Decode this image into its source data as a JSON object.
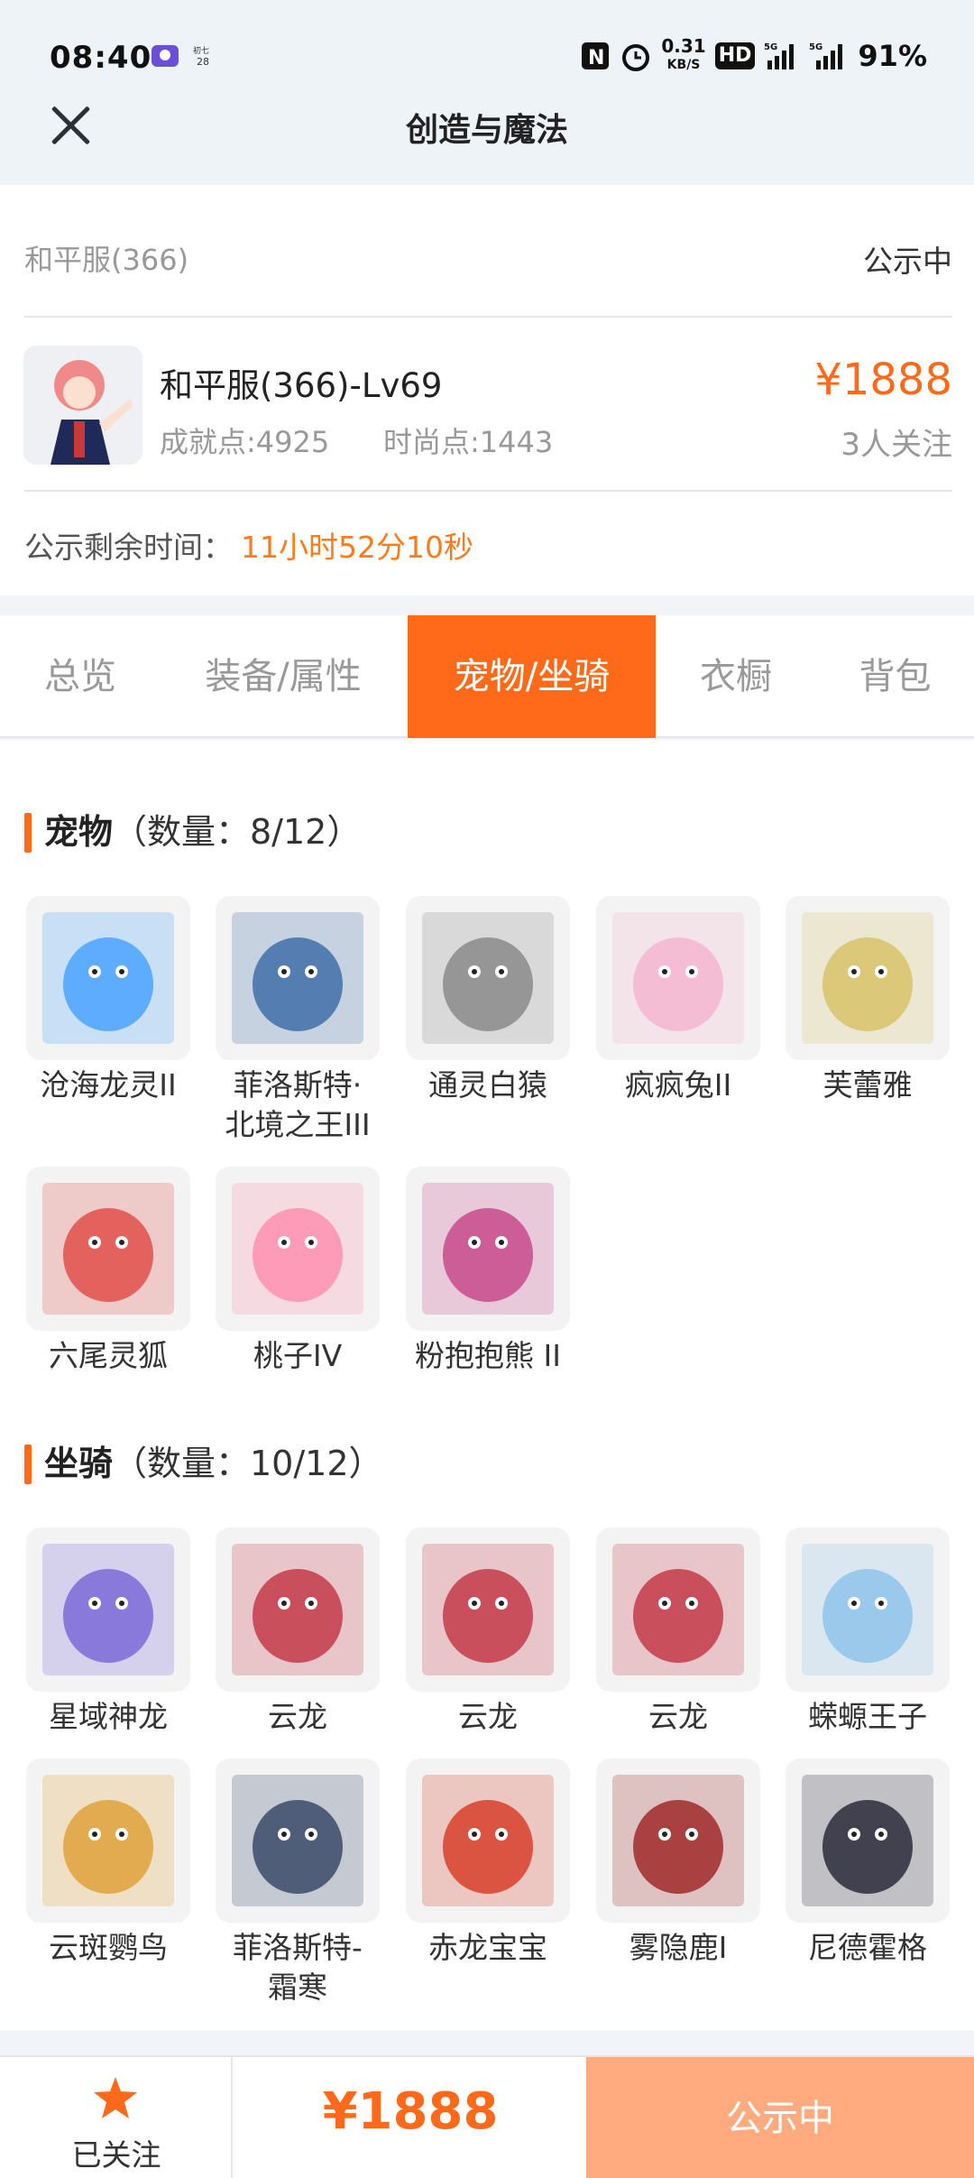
{
  "status_bar": {
    "time": "08:40",
    "speed": "0.31",
    "speed_unit": "KB/S",
    "battery": "91%",
    "hd": "HD"
  },
  "header": {
    "title": "创造与魔法",
    "close_icon": "close-icon"
  },
  "info": {
    "server": "和平服(366)",
    "status": "公示中",
    "char_name": "和平服(366)-Lv69",
    "achievement": "成就点:4925",
    "fashion": "时尚点:1443",
    "price": "¥1888",
    "followers": "3人关注",
    "remain_label": "公示剩余时间：",
    "remain_value": "11小时52分10秒"
  },
  "tabs": [
    {
      "label": "总览"
    },
    {
      "label": "装备/属性"
    },
    {
      "label": "宠物/坐骑",
      "active": true
    },
    {
      "label": "衣橱"
    },
    {
      "label": "背包"
    }
  ],
  "pets": {
    "title": "宠物",
    "count": "（数量：8/12）",
    "items": [
      {
        "name": "沧海龙灵II",
        "color": "#4aa3ff"
      },
      {
        "name": "菲洛斯特·北境之王III",
        "name1": "菲洛斯特·",
        "name2": "北境之王III",
        "color": "#3f6fa8"
      },
      {
        "name": "通灵白猿",
        "color": "#8a8a8a"
      },
      {
        "name": "疯疯兔II",
        "color": "#f3b6d0"
      },
      {
        "name": "芙蕾雅",
        "color": "#d8c26a"
      },
      {
        "name": "六尾灵狐",
        "color": "#e0504a"
      },
      {
        "name": "桃子IV",
        "color": "#ff8fb0"
      },
      {
        "name": "粉抱抱熊 II",
        "color": "#c84a8a"
      }
    ]
  },
  "mounts": {
    "title": "坐骑",
    "count": "（数量：10/12）",
    "items": [
      {
        "name": "星域神龙",
        "color": "#7a6ad8"
      },
      {
        "name": "云龙",
        "color": "#c43a4a"
      },
      {
        "name": "云龙",
        "color": "#c43a4a"
      },
      {
        "name": "云龙",
        "color": "#c43a4a"
      },
      {
        "name": "蝾螈王子",
        "color": "#8fc3ea"
      },
      {
        "name": "云斑鹦鸟",
        "color": "#e0a23a"
      },
      {
        "name": "菲洛斯特-霜寒",
        "name1": "菲洛斯特-",
        "name2": "霜寒",
        "color": "#3a4a6a"
      },
      {
        "name": "赤龙宝宝",
        "color": "#d8402a"
      },
      {
        "name": "雾隐鹿I",
        "color": "#a02a2a"
      },
      {
        "name": "尼德霍格",
        "color": "#2a2a3a"
      }
    ]
  },
  "bottom": {
    "follow_label": "已关注",
    "price": "¥1888",
    "button": "公示中"
  }
}
